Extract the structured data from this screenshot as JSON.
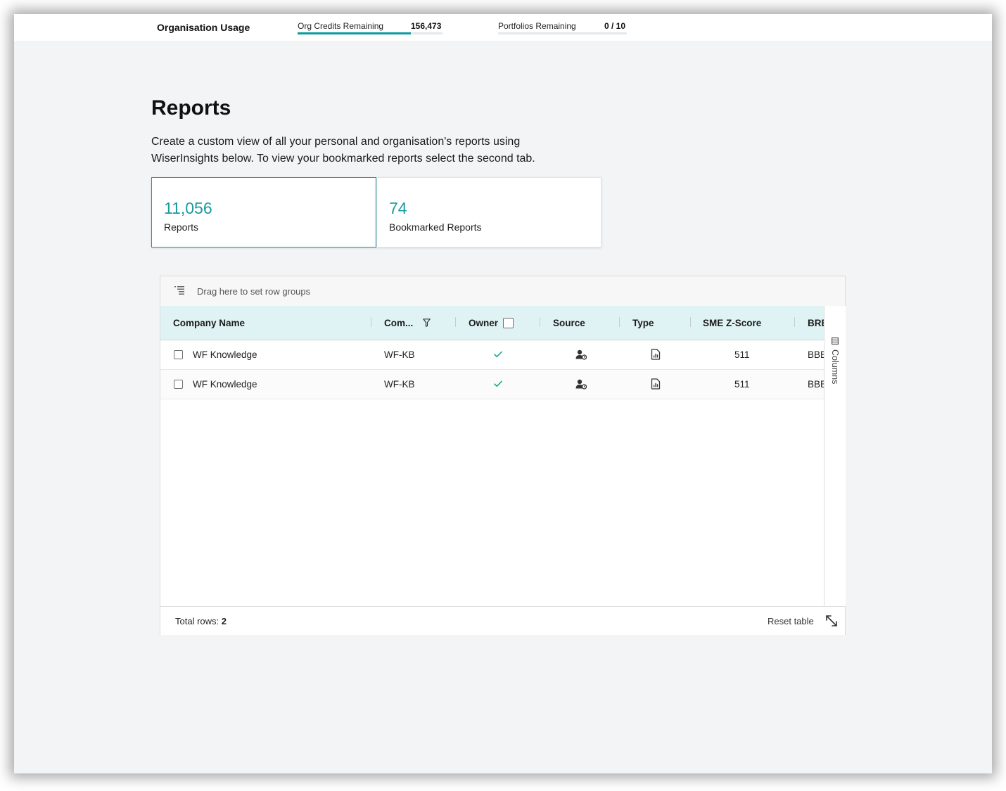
{
  "usage": {
    "title": "Organisation Usage",
    "credits_label": "Org Credits Remaining",
    "credits_value": "156,473",
    "credits_fill_fraction": 0.78,
    "portfolios_label": "Portfolios Remaining",
    "portfolios_value": "0 / 10",
    "portfolios_fill_fraction": 0
  },
  "page": {
    "title": "Reports",
    "description": "Create a custom view of all your personal and organisation's reports using WiserInsights below. To view your bookmarked reports select the second tab."
  },
  "tabs": [
    {
      "count": "11,056",
      "label": "Reports",
      "active": true
    },
    {
      "count": "74",
      "label": "Bookmarked Reports",
      "active": false
    }
  ],
  "grid": {
    "group_panel_text": "Drag here to set row groups",
    "columns": [
      "Company Name",
      "Com...",
      "Owner",
      "Source",
      "Type",
      "SME Z-Score",
      "BRE"
    ],
    "rows": [
      {
        "company_name": "WF Knowledge",
        "company_code": "WF-KB",
        "owner": "check-icon",
        "source": "user-shared-icon",
        "type": "report-document-icon",
        "sme_z_score": "511",
        "bre": "BBB"
      },
      {
        "company_name": "WF Knowledge",
        "company_code": "WF-KB",
        "owner": "check-icon",
        "source": "user-shared-icon",
        "type": "report-document-icon",
        "sme_z_score": "511",
        "bre": "BBB"
      }
    ],
    "side_panel_label": "Columns",
    "footer": {
      "total_rows_label": "Total rows:",
      "total_rows_value": "2",
      "reset_label": "Reset table"
    }
  },
  "colors": {
    "accent": "#1a9aa0",
    "header_bg": "#e0f3f4",
    "check": "#1aa38a"
  }
}
